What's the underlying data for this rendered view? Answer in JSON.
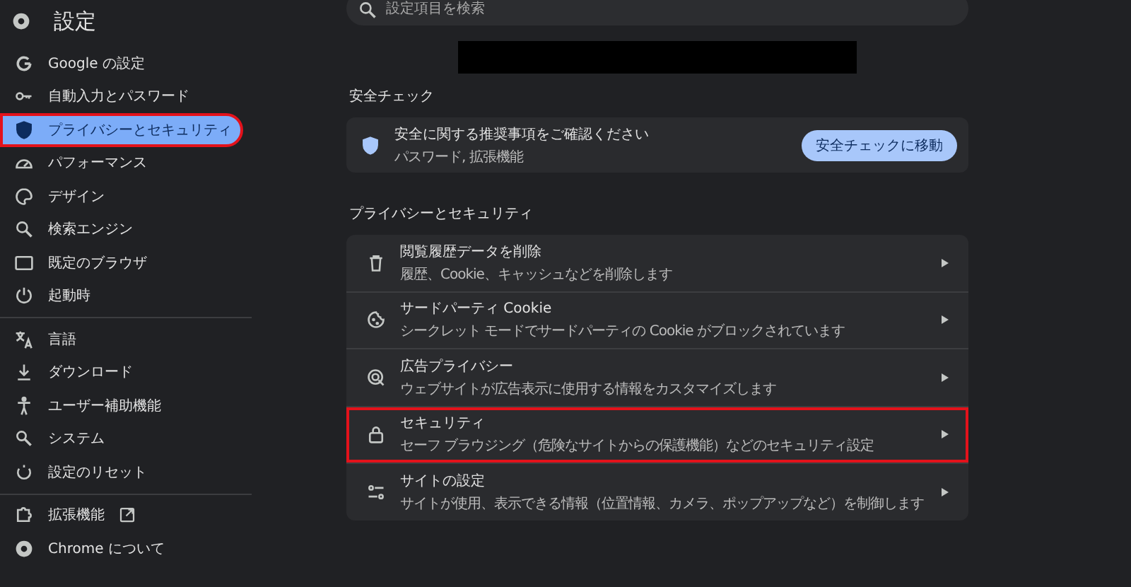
{
  "app": {
    "title": "設定"
  },
  "sidebar": {
    "groups": [
      [
        {
          "label": "Google の設定",
          "selected": false,
          "highlighted": false
        },
        {
          "label": "自動入力とパスワード",
          "selected": false,
          "highlighted": false
        },
        {
          "label": "プライバシーとセキュリティ",
          "selected": true,
          "highlighted": true
        },
        {
          "label": "パフォーマンス",
          "selected": false,
          "highlighted": false
        },
        {
          "label": "デザイン",
          "selected": false,
          "highlighted": false
        },
        {
          "label": "検索エンジン",
          "selected": false,
          "highlighted": false
        },
        {
          "label": "既定のブラウザ",
          "selected": false,
          "highlighted": false
        },
        {
          "label": "起動時",
          "selected": false,
          "highlighted": false
        }
      ],
      [
        {
          "label": "言語",
          "selected": false,
          "highlighted": false
        },
        {
          "label": "ダウンロード",
          "selected": false,
          "highlighted": false
        },
        {
          "label": "ユーザー補助機能",
          "selected": false,
          "highlighted": false
        },
        {
          "label": "システム",
          "selected": false,
          "highlighted": false
        },
        {
          "label": "設定のリセット",
          "selected": false,
          "highlighted": false
        }
      ],
      [
        {
          "label": "拡張機能",
          "selected": false,
          "highlighted": false,
          "external": true
        },
        {
          "label": "Chrome について",
          "selected": false,
          "highlighted": false,
          "external": false
        }
      ]
    ]
  },
  "search": {
    "placeholder": "設定項目を検索"
  },
  "safety_check": {
    "heading": "安全チェック",
    "title": "安全に関する推奨事項をご確認ください",
    "subtitle": "パスワード, 拡張機能",
    "button": "安全チェックに移動"
  },
  "privacy": {
    "heading": "プライバシーとセキュリティ",
    "rows": [
      {
        "title": "閲覧履歴データを削除",
        "subtitle": "履歴、Cookie、キャッシュなどを削除します",
        "highlighted": false
      },
      {
        "title": "サードパーティ Cookie",
        "subtitle": "シークレット モードでサードパーティの Cookie がブロックされています",
        "highlighted": false
      },
      {
        "title": "広告プライバシー",
        "subtitle": "ウェブサイトが広告表示に使用する情報をカスタマイズします",
        "highlighted": false
      },
      {
        "title": "セキュリティ",
        "subtitle": "セーフ ブラウジング（危険なサイトからの保護機能）などのセキュリティ設定",
        "highlighted": true
      },
      {
        "title": "サイトの設定",
        "subtitle": "サイトが使用、表示できる情報（位置情報、カメラ、ポップアップなど）を制御します",
        "highlighted": false
      }
    ]
  }
}
